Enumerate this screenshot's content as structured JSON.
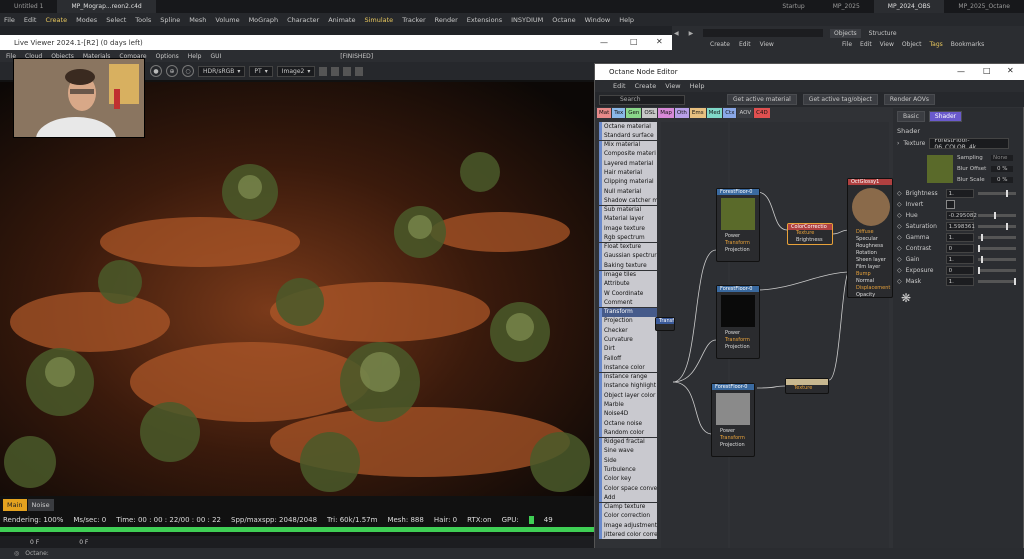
{
  "top_tabs": [
    "Untitled 1",
    "MP_Mograp...reon2.c4d",
    "Startup",
    "MP_2025",
    "MP_2024_OBS",
    "MP_2025_Octane"
  ],
  "main_menu": [
    "File",
    "Edit",
    "Create",
    "Modes",
    "Select",
    "Tools",
    "Spline",
    "Mesh",
    "Volume",
    "MoGraph",
    "Character",
    "Animate",
    "Simulate",
    "Tracker",
    "Render",
    "Extensions",
    "INSYDIUM",
    "Octane",
    "Window",
    "Help"
  ],
  "live_viewer": {
    "title": "Live Viewer 2024.1-[R2] (0 days left)",
    "menu": [
      "File",
      "Cloud",
      "Objects",
      "Materials",
      "Compare",
      "Options",
      "Help",
      "GUI"
    ],
    "status_center": "[FINISHED]",
    "toolbar": {
      "mode": "HDR/sRGB",
      "pt": "PT",
      "image": "Image2"
    },
    "bottom_tabs": [
      "Main",
      "Noise"
    ],
    "status": {
      "rendering": "Rendering: 100%",
      "ms_sec": "Ms/sec: 0",
      "time": "Time: 00 : 00 : 22/00 : 00 : 22",
      "spp": "Spp/maxspp: 2048/2048",
      "tri": "Tri: 60k/1.57m",
      "mesh": "Mesh: 888",
      "hair": "Hair: 0",
      "rtx": "RTX:on",
      "gpu": "GPU:",
      "gpu_val": "49"
    },
    "progress": 1.0,
    "frame_start": "0 F",
    "frame_end": "0 F"
  },
  "right_panel": {
    "tabs": [
      "Objects",
      "Structure"
    ],
    "menu": [
      "File",
      "Edit",
      "View",
      "Object",
      "Tags",
      "Bookmarks"
    ],
    "create_menu": [
      "Create",
      "Edit",
      "View"
    ]
  },
  "node_editor": {
    "title": "Octane Node Editor",
    "menu": [
      "Edit",
      "Create",
      "View",
      "Help"
    ],
    "search_placeholder": "Search",
    "buttons": [
      "Get active material",
      "Get active tag/object",
      "Render AOVs"
    ],
    "categories": [
      {
        "label": "Mat",
        "color": "#e88a8a"
      },
      {
        "label": "Tex",
        "color": "#8ab8e8"
      },
      {
        "label": "Gen",
        "color": "#8ad88a"
      },
      {
        "label": "OSL",
        "color": "#c8c8c8"
      },
      {
        "label": "Map",
        "color": "#d88ad8"
      },
      {
        "label": "Oth",
        "color": "#b8a0e8"
      },
      {
        "label": "Ems",
        "color": "#e8c080"
      },
      {
        "label": "Med",
        "color": "#80d8c8"
      },
      {
        "label": "Ctx",
        "color": "#8aa8e8"
      },
      {
        "label": "AOV",
        "color": "#3b3d42"
      },
      {
        "label": "C4D",
        "color": "#e05050"
      }
    ],
    "list": [
      "Octane material",
      "Standard surface",
      "Mix material",
      "Composite materi",
      "Layered material",
      "Hair material",
      "Clipping material",
      "Null material",
      "Shadow catcher m",
      "Sub material",
      "Material layer",
      "Image texture",
      "Rgb spectrum",
      "Float texture",
      "Gaussian spectrur",
      "Baking texture",
      "Image tiles",
      "Attribute",
      "W Coordinate",
      "Comment",
      "Transform",
      "Projection",
      "Checker",
      "Curvature",
      "Dirt",
      "Falloff",
      "Instance color",
      "Instance range",
      "Instance highlight",
      "Object layer color",
      "Marble",
      "Noise4D",
      "Octane noise",
      "Random color",
      "Ridged fractal",
      "Sine wave",
      "Side",
      "Turbulence",
      "Color key",
      "Color space conve",
      "Add",
      "Clamp texture",
      "Color correction",
      "Image adjustment",
      "Jittered color corre"
    ],
    "nodes": {
      "tex1": {
        "title": "ForestFloor-0",
        "ports": [
          "Power",
          "Transform",
          "Projection"
        ]
      },
      "tex2": {
        "title": "ForestFloor-0",
        "ports": [
          "Power",
          "Transform",
          "Projection"
        ]
      },
      "tex3": {
        "title": "ForestFloor-0",
        "ports": [
          "Power",
          "Transform",
          "Projection"
        ]
      },
      "cc": {
        "title": "ColorCorrectio",
        "ports": [
          "Texture",
          "Brightness"
        ]
      },
      "mat": {
        "title": "OctGlossy1",
        "ports": [
          "Diffuse",
          "Specular",
          "Roughness",
          "Rotation",
          "Sheen layer",
          "Film layer",
          "Bump",
          "Normal",
          "Displacement",
          "Opacity"
        ]
      },
      "transform": {
        "title": "Transform"
      },
      "small": {
        "title": "",
        "ports": [
          "Texture"
        ]
      }
    },
    "attr": {
      "tabs": [
        "Basic",
        "Shader"
      ],
      "section": "Shader",
      "texture_label": "Texture",
      "texture_name": "ForestFloor-06_COLOR_4k",
      "sampling_label": "Sampling",
      "sampling_val": "None",
      "blur_offset_label": "Blur Offset",
      "blur_offset_val": "0 %",
      "blur_scale_label": "Blur Scale",
      "blur_scale_val": "0 %",
      "rows": [
        {
          "label": "Brightness",
          "value": "1.",
          "slider": 0.8
        },
        {
          "label": "Invert",
          "value": "",
          "slider": null
        },
        {
          "label": "Hue",
          "value": "-0.295082",
          "slider": 0.45
        },
        {
          "label": "Saturation",
          "value": "1.598361",
          "slider": 0.8
        },
        {
          "label": "Gamma",
          "value": "1.",
          "slider": 0.1
        },
        {
          "label": "Contrast",
          "value": "0",
          "slider": 0.0
        },
        {
          "label": "Gain",
          "value": "1.",
          "slider": 0.1
        },
        {
          "label": "Exposure",
          "value": "0",
          "slider": 0.0
        },
        {
          "label": "Mask",
          "value": "1.",
          "slider": 1.0
        }
      ]
    }
  },
  "footer": {
    "label": "Octane:"
  }
}
